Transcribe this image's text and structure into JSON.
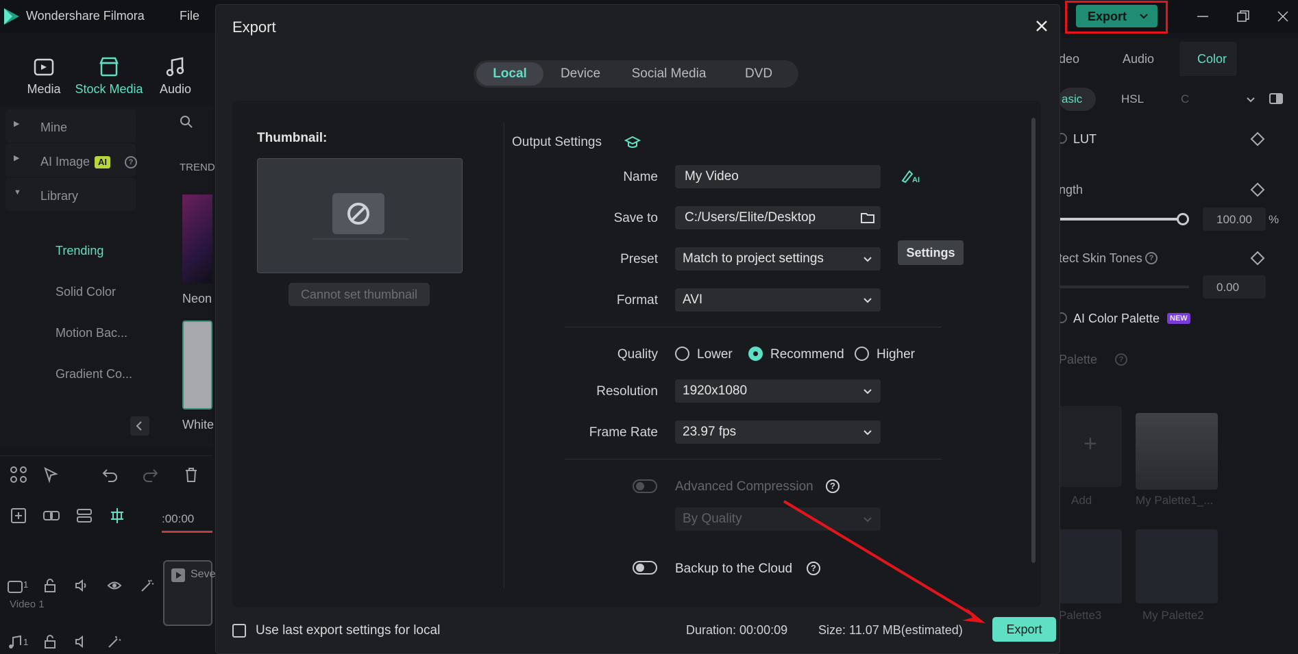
{
  "app": {
    "title": "Wondershare Filmora",
    "menu_file": "File",
    "top_export_label": "Export",
    "nav_tabs": [
      {
        "label": "Media"
      },
      {
        "label": "Stock Media"
      },
      {
        "label": "Audio"
      }
    ],
    "library": {
      "items": [
        "Mine",
        "AI Image",
        "Library",
        "Trending",
        "Solid Color",
        "Motion Bac...",
        "Gradient Co..."
      ],
      "ai_badge": "AI"
    },
    "media_labels": [
      "TRENDI",
      "Neon",
      "White"
    ],
    "timeline": {
      "time": ":00:00",
      "track_video": "Video 1",
      "track_video_num": "1",
      "track_audio_num": "1",
      "clip_label": "Seve"
    },
    "right_panel": {
      "tabs": [
        "deo",
        "Audio",
        "Color"
      ],
      "subtabs": [
        "asic",
        "HSL",
        "C"
      ],
      "lut": "LUT",
      "strength": "ngth",
      "strength_value": "100.00",
      "strength_unit": "%",
      "skin_tones": "tect Skin Tones",
      "skin_value": "0.00",
      "palette_title": "AI Color Palette",
      "new_badge": "NEW",
      "palette_sub": "Palette",
      "add": "Add",
      "palettes": [
        "My Palette1_...",
        "Palette3",
        "My Palette2"
      ]
    }
  },
  "dialog": {
    "title": "Export",
    "tabs": [
      "Local",
      "Device",
      "Social Media",
      "DVD"
    ],
    "active_tab": "Local",
    "thumbnail_label": "Thumbnail:",
    "cannot_set_thumbnail": "Cannot set thumbnail",
    "output_settings": "Output Settings",
    "labels": {
      "name": "Name",
      "save_to": "Save to",
      "preset": "Preset",
      "format": "Format",
      "quality": "Quality",
      "resolution": "Resolution",
      "frame_rate": "Frame Rate"
    },
    "values": {
      "name": "My Video",
      "save_to": "C:/Users/Elite/Desktop",
      "preset": "Match to project settings",
      "format": "AVI",
      "resolution": "1920x1080",
      "frame_rate": "23.97 fps",
      "by_quality": "By Quality"
    },
    "settings_button": "Settings",
    "quality_options": [
      "Lower",
      "Recommend",
      "Higher"
    ],
    "quality_selected": "Recommend",
    "advanced_compression": "Advanced Compression",
    "backup_cloud": "Backup to the Cloud",
    "help_glyph": "?",
    "use_last": "Use last export settings for local",
    "duration": "Duration: 00:00:09",
    "size": "Size: 11.07 MB(estimated)",
    "export_button": "Export"
  },
  "colors": {
    "accent": "#5fe0c5",
    "highlight_box": "#e3151a",
    "annotation_arrow": "#e3151a"
  }
}
